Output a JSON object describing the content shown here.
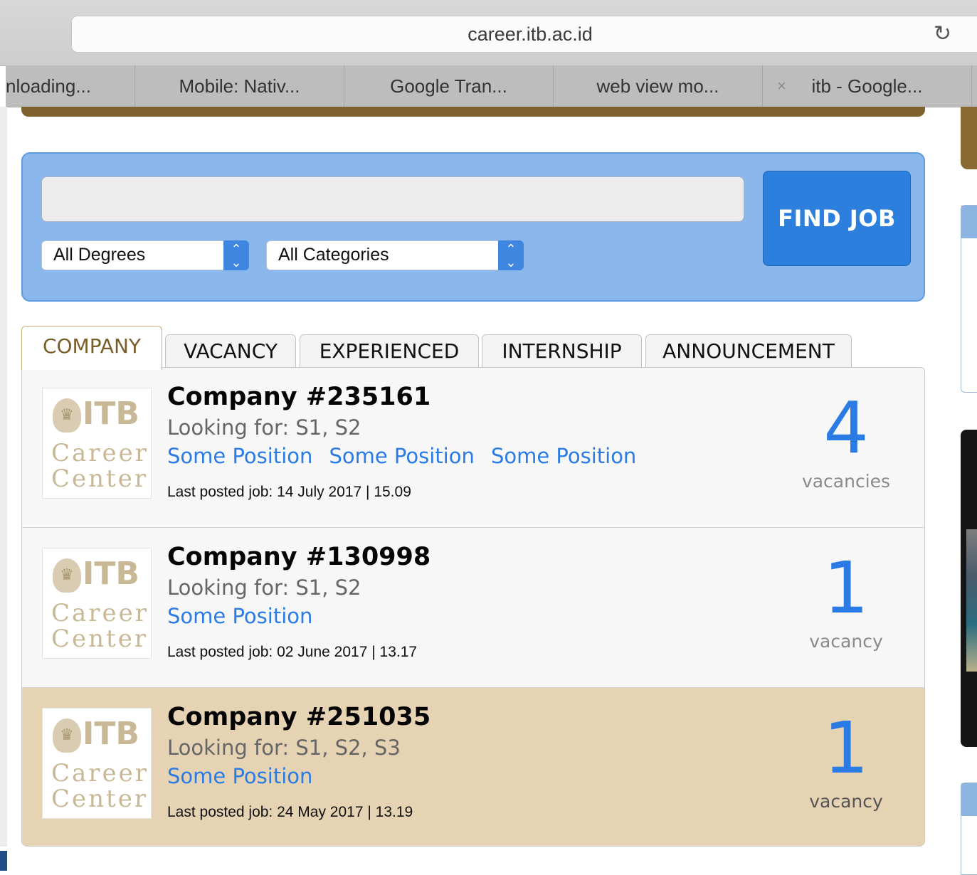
{
  "browser": {
    "url": "career.itb.ac.id",
    "reload_icon": "reload-icon",
    "tabs": [
      {
        "label": "nloading..."
      },
      {
        "label": "Mobile: Nativ..."
      },
      {
        "label": "Google Tran..."
      },
      {
        "label": "web view mo..."
      },
      {
        "label": "itb - Google..."
      }
    ]
  },
  "search": {
    "query_value": "",
    "degree_select": "All Degrees",
    "category_select": "All Categories",
    "find_button": "FIND JOB"
  },
  "content_tabs": [
    {
      "label": "COMPANY",
      "active": true
    },
    {
      "label": "VACANCY",
      "active": false
    },
    {
      "label": "EXPERIENCED",
      "active": false
    },
    {
      "label": "INTERNSHIP",
      "active": false
    },
    {
      "label": "ANNOUNCEMENT",
      "active": false
    }
  ],
  "logo": {
    "itb": "ITB",
    "line1": "Career",
    "line2": "Center"
  },
  "companies": [
    {
      "name": "Company #235161",
      "looking_for": "Looking for: S1, S2",
      "positions": [
        "Some Position",
        "Some Position",
        "Some Position"
      ],
      "last_posted": "Last posted job: 14 July 2017 | 15.09",
      "vacancy_count": "4",
      "vacancy_label": "vacancies"
    },
    {
      "name": "Company #130998",
      "looking_for": "Looking for: S1, S2",
      "positions": [
        "Some Position"
      ],
      "last_posted": "Last posted job: 02 June 2017 | 13.17",
      "vacancy_count": "1",
      "vacancy_label": "vacancy"
    },
    {
      "name": "Company #251035",
      "looking_for": "Looking for: S1, S2, S3",
      "positions": [
        "Some Position"
      ],
      "last_posted": "Last posted job: 24 May 2017 | 13.19",
      "vacancy_count": "1",
      "vacancy_label": "vacancy"
    }
  ],
  "colors": {
    "accent_blue": "#2b7be4",
    "search_panel": "#8ab7ec",
    "highlight_row": "#e5d3b3",
    "active_tab_text": "#7a5e2a"
  }
}
